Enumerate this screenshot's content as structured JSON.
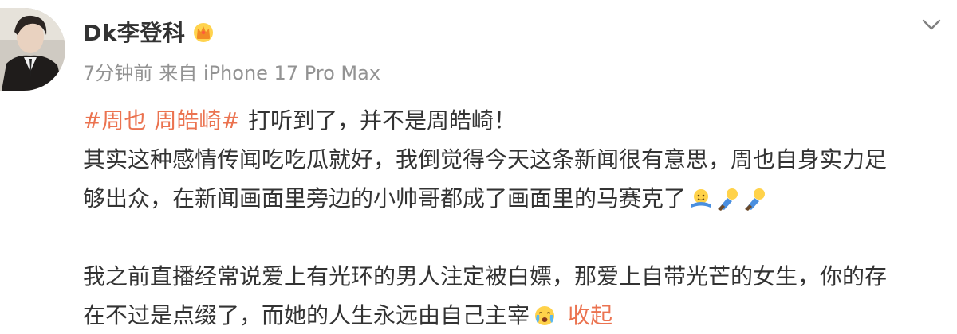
{
  "post": {
    "username": "Dk李登科",
    "time": "7分钟前",
    "source": "来自 iPhone 17 Pro Max",
    "topic1": "#周也",
    "topic2": "周皓崎#",
    "line1_text": "打听到了，并不是周皓崎！",
    "line2": "其实这种感情传闻吃吃瓜就好，我倒觉得今天这条新闻很有意思，周也自身实力足",
    "line3": "够出众，在新闻画面里旁边的小帅哥都成了画面里的马赛克了",
    "line4": "我之前直播经常说爱上有光环的男人注定被白嫖，那爱上自带光芒的女生，你的存",
    "line5": "在不过是点缀了，而她的人生永远由自己主宰",
    "collapse_label": "收起"
  },
  "icons": {
    "avatar": "avatar-photo",
    "verified": "crown-icon",
    "menu": "chevron-down-icon",
    "emoji_1": "hug-emoji",
    "emoji_2": "bow-emoji",
    "emoji_3": "bow-emoji",
    "emoji_4": "crying-face-emoji"
  },
  "colors": {
    "text": "#333333",
    "meta": "#939393",
    "accent": "#eb7350"
  }
}
